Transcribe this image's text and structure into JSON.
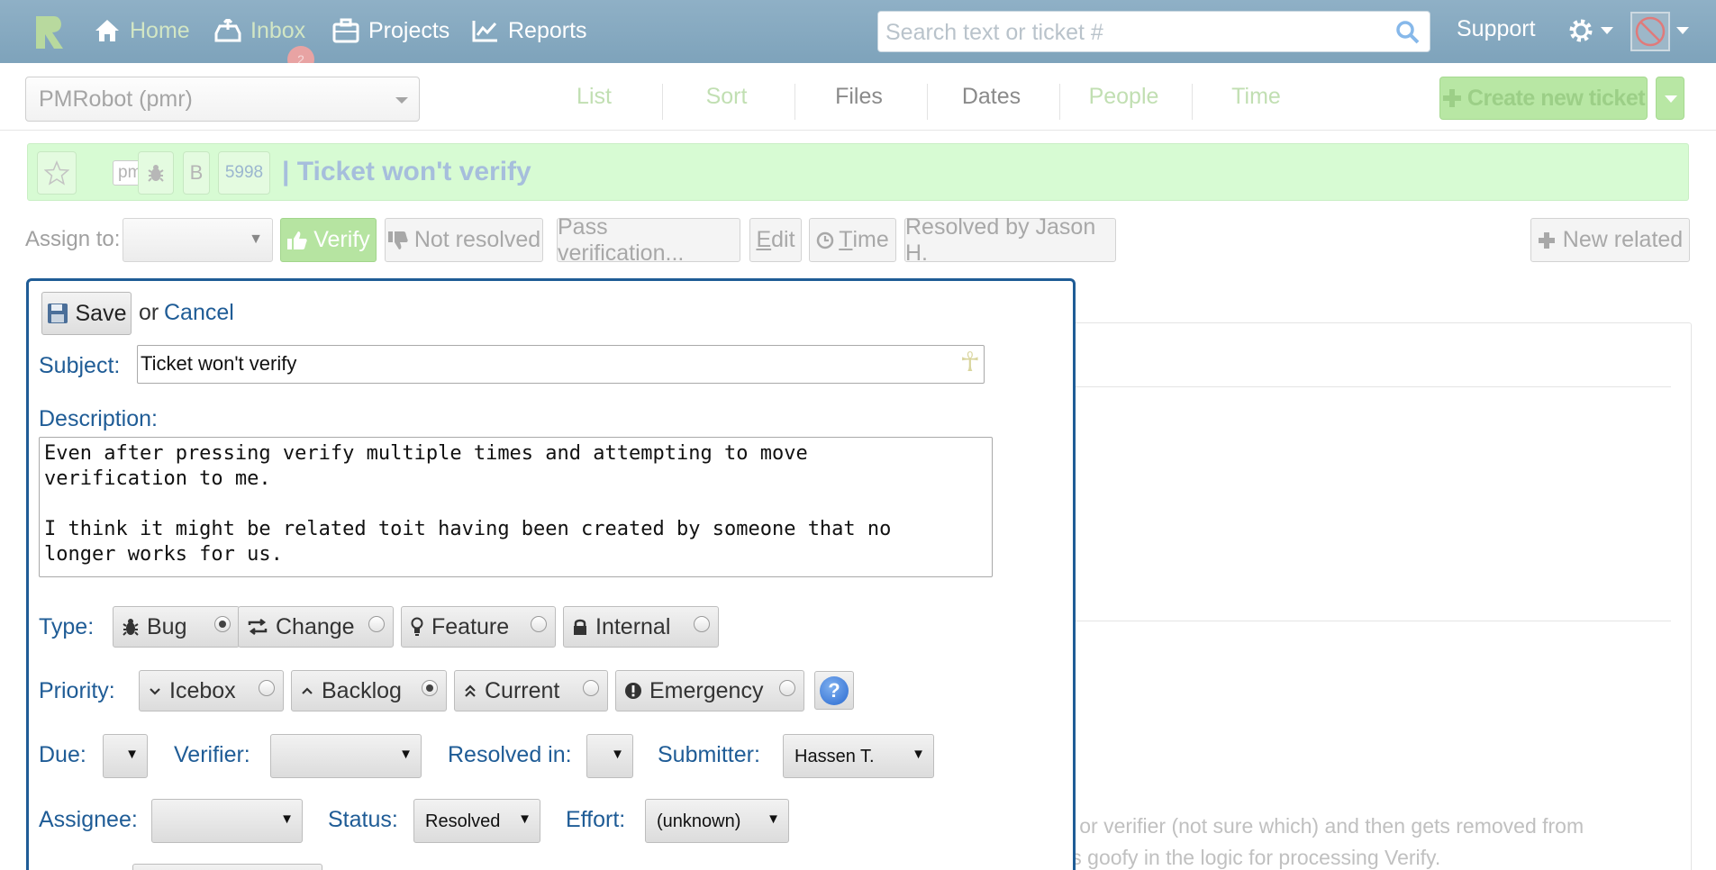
{
  "nav": {
    "home": "Home",
    "inbox": "Inbox",
    "inbox_count": "2",
    "projects": "Projects",
    "reports": "Reports",
    "search_placeholder": "Search text or ticket #",
    "support": "Support"
  },
  "subbar": {
    "project": "PMRobot (pmr)",
    "tabs": [
      "List",
      "Sort",
      "Files",
      "Dates",
      "People",
      "Time"
    ],
    "create_button": "Create new ticket"
  },
  "ticket": {
    "project_tag": "pmr",
    "type_tag": "B",
    "number": "5998",
    "title": "| Ticket won't verify"
  },
  "actions": {
    "assign_label": "Assign to:",
    "verify": "Verify",
    "not_resolved": "Not resolved",
    "pass_verification": "Pass verification...",
    "edit_first": "E",
    "edit_rest": "dit",
    "time_first": "T",
    "time_rest": "ime",
    "resolved_by": "Resolved by Jason H.",
    "new_related": "New related"
  },
  "background": {
    "line1": "ter or verifier (not sure which) and then gets removed from",
    "line2": "g is goofy in the logic for processing Verify."
  },
  "form": {
    "save": "Save",
    "or": "or",
    "cancel": "Cancel",
    "subject_label": "Subject:",
    "subject_value": "Ticket won't verify",
    "description_label": "Description:",
    "description_value": "Even after pressing verify multiple times and attempting to move\nverification to me.\n\nI think it might be related toit having been created by someone that no\nlonger works for us.",
    "type_label": "Type:",
    "types": [
      {
        "label": "Bug",
        "selected": true,
        "icon": "bug-icon"
      },
      {
        "label": "Change",
        "selected": false,
        "icon": "change-icon"
      },
      {
        "label": "Feature",
        "selected": false,
        "icon": "lightbulb-icon"
      },
      {
        "label": "Internal",
        "selected": false,
        "icon": "lock-icon"
      }
    ],
    "priority_label": "Priority:",
    "priorities": [
      {
        "label": "Icebox",
        "selected": false,
        "icon": "chevron-down-icon"
      },
      {
        "label": "Backlog",
        "selected": true,
        "icon": "chevron-up-icon"
      },
      {
        "label": "Current",
        "selected": false,
        "icon": "double-chevron-up-icon"
      },
      {
        "label": "Emergency",
        "selected": false,
        "icon": "exclamation-icon"
      }
    ],
    "help": "?",
    "due_label": "Due:",
    "due_value": "",
    "verifier_label": "Verifier:",
    "verifier_value": "",
    "resolved_in_label": "Resolved in:",
    "resolved_in_value": "",
    "submitter_label": "Submitter:",
    "submitter_value": "Hassen T.",
    "assignee_label": "Assignee:",
    "assignee_value": "",
    "status_label": "Status:",
    "status_value": "Resolved",
    "effort_label": "Effort:",
    "effort_value": "(unknown)",
    "dropdown_arrow": "▼"
  },
  "colors": {
    "navbar": "#8fb0c6",
    "form_border": "#1f5c96",
    "ticket_header_bg": "#d7fbd3",
    "verify_bg": "#b6e4a1"
  }
}
